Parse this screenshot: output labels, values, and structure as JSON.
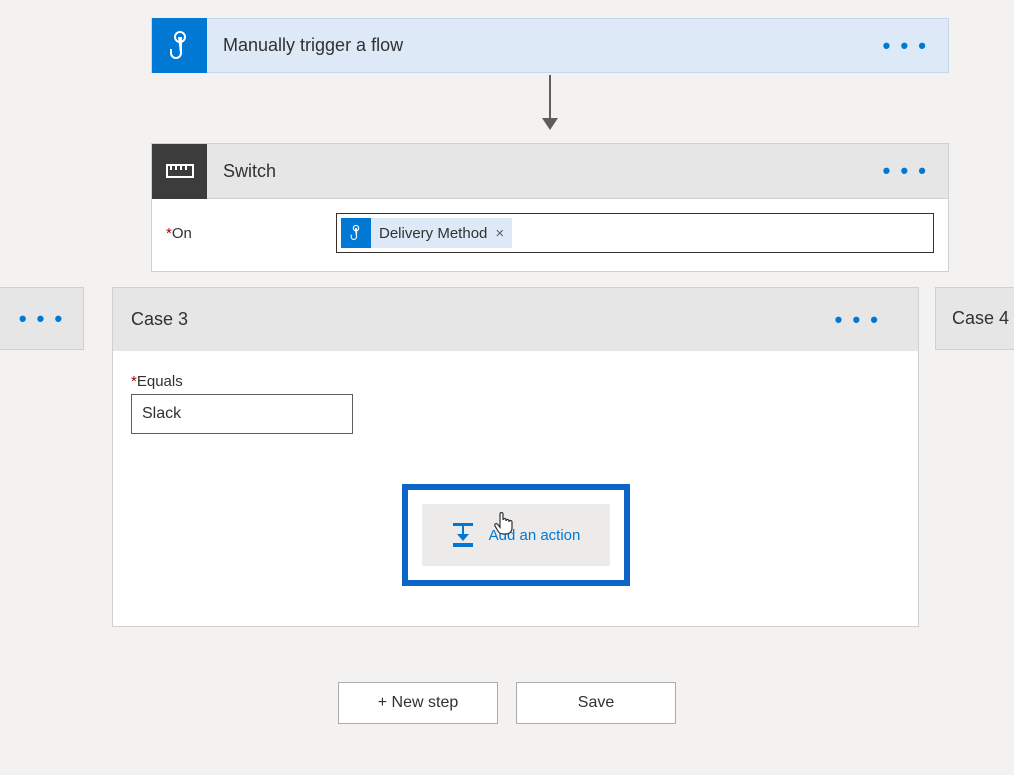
{
  "trigger": {
    "label": "Manually trigger a flow"
  },
  "switch": {
    "label": "Switch",
    "on_field_label": "On",
    "on_token": "Delivery Method",
    "on_token_remove": "×"
  },
  "cases": {
    "prev_ellipsis": "• • •",
    "current": {
      "title": "Case 3",
      "equals_label": "Equals",
      "equals_value": "Slack",
      "add_action_label": "Add an action"
    },
    "next": {
      "title": "Case 4"
    }
  },
  "buttons": {
    "new_step": "+ New step",
    "save": "Save"
  },
  "required_marker": "*"
}
